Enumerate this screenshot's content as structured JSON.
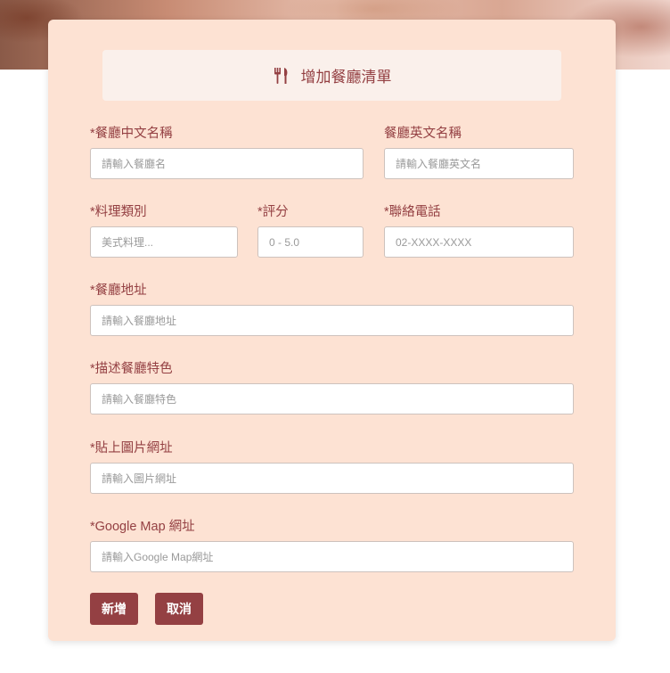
{
  "form": {
    "title": "增加餐廳清單",
    "title_icon": "utensils-icon",
    "fields": {
      "name_zh": {
        "label": "*餐廳中文名稱",
        "placeholder": "請輸入餐廳名"
      },
      "name_en": {
        "label": "餐廳英文名稱",
        "placeholder": "請輸入餐廳英文名"
      },
      "category": {
        "label": "*料理類別",
        "placeholder": "美式料理..."
      },
      "rating": {
        "label": "*評分",
        "placeholder": "0 - 5.0"
      },
      "phone": {
        "label": "*聯絡電話",
        "placeholder": "02-XXXX-XXXX"
      },
      "address": {
        "label": "*餐廳地址",
        "placeholder": "請輸入餐廳地址"
      },
      "description": {
        "label": "*描述餐廳特色",
        "placeholder": "請輸入餐廳特色"
      },
      "image_url": {
        "label": "*貼上圖片網址",
        "placeholder": "請輸入圖片網址"
      },
      "map_url": {
        "label": "*Google Map 網址",
        "placeholder": "請輸入Google Map網址"
      }
    },
    "buttons": {
      "submit": "新增",
      "cancel": "取消"
    }
  },
  "colors": {
    "accent": "#944043",
    "card_background": "#fde2d3",
    "header_background": "#faf0eb"
  }
}
